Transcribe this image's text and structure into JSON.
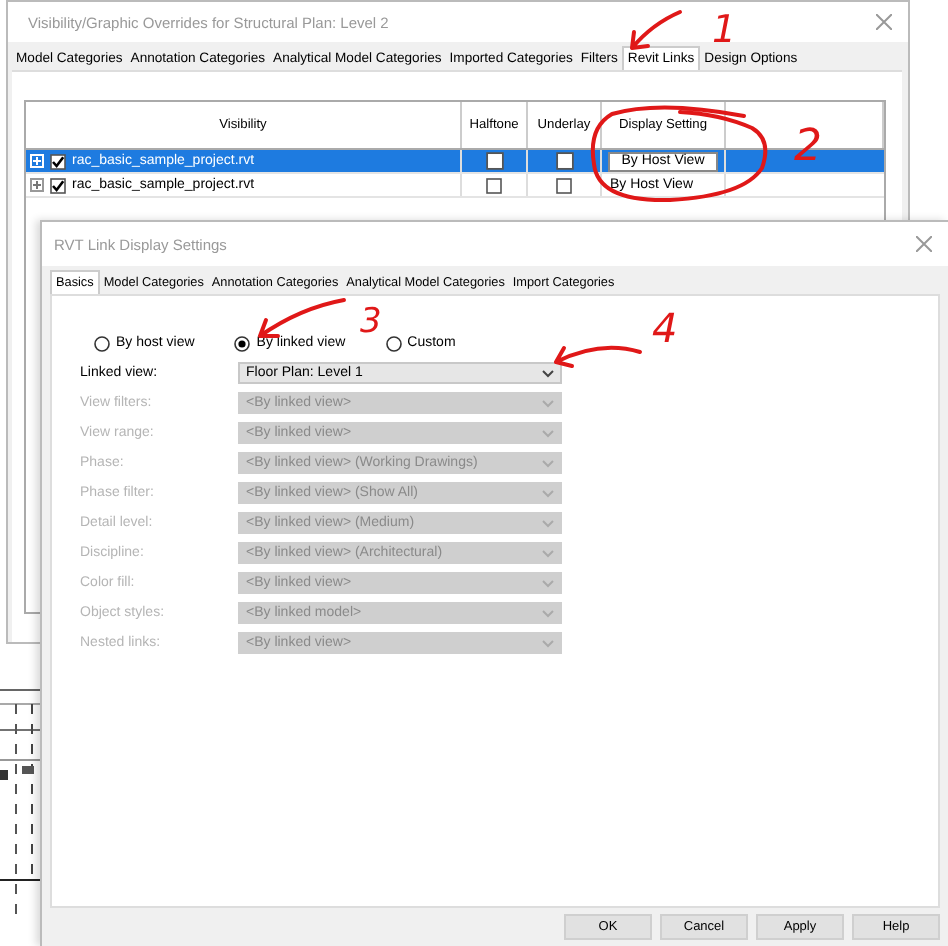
{
  "background_dialog": {
    "title": "Visibility/Graphic Overrides for Structural Plan: Level 2",
    "tabs": [
      {
        "label": "Model Categories",
        "selected": false
      },
      {
        "label": "Annotation Categories",
        "selected": false
      },
      {
        "label": "Analytical Model Categories",
        "selected": false
      },
      {
        "label": "Imported Categories",
        "selected": false
      },
      {
        "label": "Filters",
        "selected": false
      },
      {
        "label": "Revit Links",
        "selected": true
      },
      {
        "label": "Design Options",
        "selected": false
      }
    ],
    "table": {
      "columns": [
        "Visibility",
        "Halftone",
        "Underlay",
        "Display Setting"
      ],
      "rows": [
        {
          "name": "rac_basic_sample_project.rvt",
          "selected": true,
          "visible": true,
          "halftone": false,
          "underlay": false,
          "display": "By Host View"
        },
        {
          "name": "rac_basic_sample_project.rvt",
          "selected": false,
          "visible": true,
          "halftone": false,
          "underlay": false,
          "display": "By Host View"
        }
      ]
    }
  },
  "link_dialog": {
    "title": "RVT Link Display Settings",
    "tabs": [
      {
        "label": "Basics",
        "selected": true
      },
      {
        "label": "Model Categories",
        "selected": false
      },
      {
        "label": "Annotation Categories",
        "selected": false
      },
      {
        "label": "Analytical Model Categories",
        "selected": false
      },
      {
        "label": "Import Categories",
        "selected": false
      }
    ],
    "radios": [
      {
        "label": "By host view",
        "selected": false
      },
      {
        "label": "By linked view",
        "selected": true
      },
      {
        "label": "Custom",
        "selected": false
      }
    ],
    "fields": [
      {
        "label": "Linked view:",
        "value": "Floor Plan: Level 1",
        "disabled": false
      },
      {
        "label": "View filters:",
        "value": "<By linked view>",
        "disabled": true
      },
      {
        "label": "View range:",
        "value": "<By linked view>",
        "disabled": true
      },
      {
        "label": "Phase:",
        "value": "<By linked view> (Working Drawings)",
        "disabled": true
      },
      {
        "label": "Phase filter:",
        "value": "<By linked view> (Show All)",
        "disabled": true
      },
      {
        "label": "Detail level:",
        "value": "<By linked view> (Medium)",
        "disabled": true
      },
      {
        "label": "Discipline:",
        "value": "<By linked view> (Architectural)",
        "disabled": true
      },
      {
        "label": "Color fill:",
        "value": "<By linked view>",
        "disabled": true
      },
      {
        "label": "Object styles:",
        "value": "<By linked model>",
        "disabled": true
      },
      {
        "label": "Nested links:",
        "value": "<By linked view>",
        "disabled": true
      }
    ],
    "buttons": [
      "OK",
      "Cancel",
      "Apply",
      "Help"
    ]
  },
  "annotations": [
    {
      "kind": "arrow"
    },
    {
      "kind": "number",
      "text": "1"
    },
    {
      "kind": "circle"
    },
    {
      "kind": "number",
      "text": "2"
    },
    {
      "kind": "arrow"
    },
    {
      "kind": "number",
      "text": "3"
    },
    {
      "kind": "arrow"
    },
    {
      "kind": "number",
      "text": "4"
    }
  ]
}
